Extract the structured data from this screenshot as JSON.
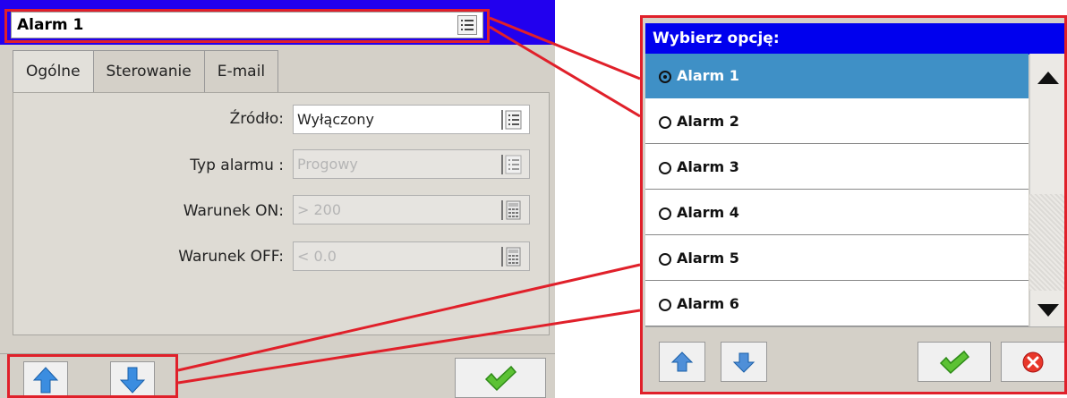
{
  "left_panel": {
    "title": "Alarm 1",
    "tabs": [
      "Ogólne",
      "Sterowanie",
      "E-mail"
    ],
    "fields": [
      {
        "label": "Źródło:",
        "value": "Wyłączony",
        "disabled": false,
        "button": "list"
      },
      {
        "label": "Typ alarmu :",
        "value": "Progowy",
        "disabled": true,
        "button": "list"
      },
      {
        "label": "Warunek ON:",
        "value": "> 200",
        "disabled": true,
        "button": "calculator"
      },
      {
        "label": "Warunek OFF:",
        "value": "< 0.0",
        "disabled": true,
        "button": "calculator"
      }
    ]
  },
  "dialog": {
    "title": "Wybierz opcję:",
    "options": [
      "Alarm 1",
      "Alarm 2",
      "Alarm 3",
      "Alarm 4",
      "Alarm 5",
      "Alarm 6"
    ],
    "selected_index": 0
  },
  "colors": {
    "title_bar": "#0000ee",
    "selection": "#3f90c6",
    "callout": "#e0202a",
    "panel": "#d4d0c8"
  },
  "icons": [
    "list-icon",
    "calculator-icon",
    "arrow-up-icon",
    "arrow-down-icon",
    "check-icon",
    "cancel-icon",
    "scroll-up-icon",
    "scroll-down-icon"
  ]
}
